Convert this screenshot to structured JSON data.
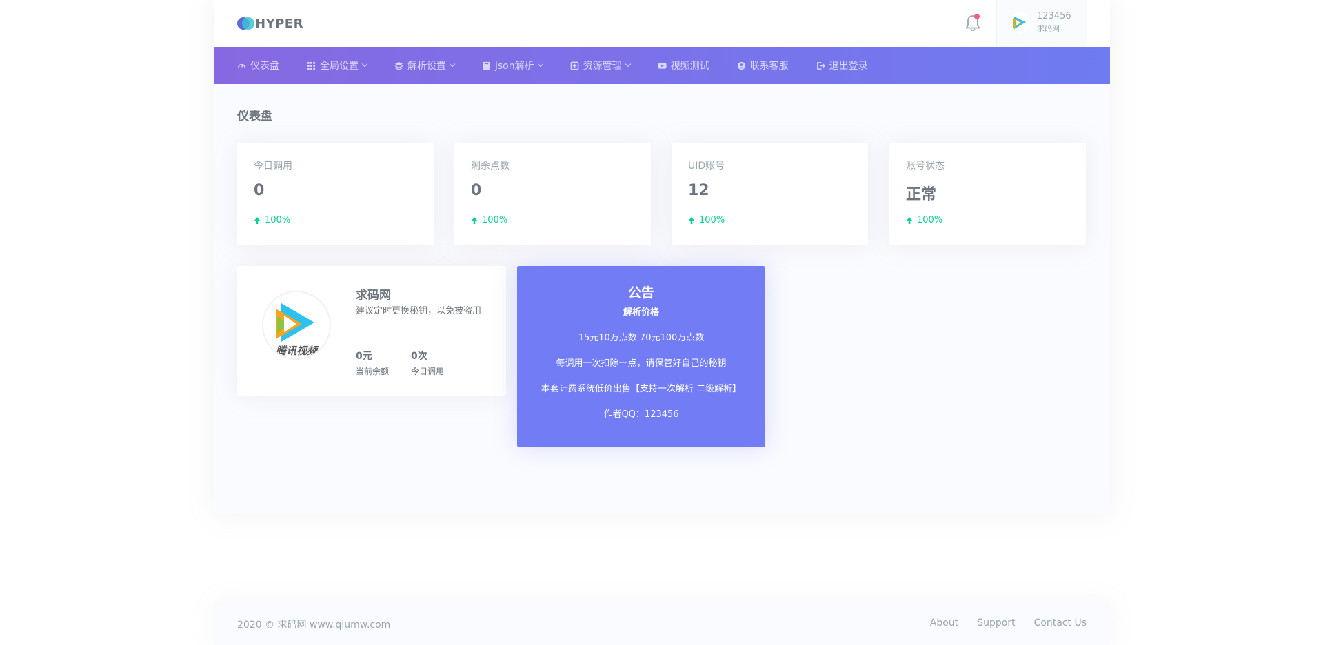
{
  "brand": {
    "name": "HYPER"
  },
  "topbar": {
    "user_name": "123456",
    "user_role": "求码网"
  },
  "nav": {
    "items": [
      {
        "label": "仪表盘",
        "icon": "dashboard-icon",
        "caret": false
      },
      {
        "label": "全局设置",
        "icon": "grid-icon",
        "caret": true
      },
      {
        "label": "解析设置",
        "icon": "layers-icon",
        "caret": true
      },
      {
        "label": "json解析",
        "icon": "book-icon",
        "caret": true
      },
      {
        "label": "资源管理",
        "icon": "resource-icon",
        "caret": true
      },
      {
        "label": "视频测试",
        "icon": "video-icon",
        "caret": false
      },
      {
        "label": "联系客服",
        "icon": "contact-icon",
        "caret": false
      },
      {
        "label": "退出登录",
        "icon": "logout-icon",
        "caret": false
      }
    ]
  },
  "page": {
    "title": "仪表盘"
  },
  "stats": [
    {
      "label": "今日调用",
      "value": "0",
      "change": "100%"
    },
    {
      "label": "剩余点数",
      "value": "0",
      "change": "100%"
    },
    {
      "label": "UID账号",
      "value": "12",
      "change": "100%"
    },
    {
      "label": "账号状态",
      "value": "正常",
      "change": "100%"
    }
  ],
  "profile": {
    "name": "求码网",
    "desc": "建议定时更换秘钥，以免被盗用",
    "balance_value": "0元",
    "balance_label": "当前余额",
    "calls_value": "0次",
    "calls_label": "今日调用",
    "avatar_text": "腾讯视频"
  },
  "notice": {
    "title": "公告",
    "subtitle": "解析价格",
    "lines": [
      "15元10万点数 70元100万点数",
      "每调用一次扣除一点，请保管好自己的秘钥",
      "本套计费系统低价出售【支持一次解析 二级解析】",
      "作者QQ：123456"
    ]
  },
  "footer": {
    "copyright": "2020 © 求码网 www.qiumw.com",
    "links": [
      "About",
      "Support",
      "Contact Us"
    ]
  },
  "colors": {
    "primary": "#727cf5",
    "success": "#0acf97",
    "danger": "#fa5c7c",
    "nav_gradient_start": "#8669e2",
    "nav_gradient_end": "#6f7bf1"
  }
}
